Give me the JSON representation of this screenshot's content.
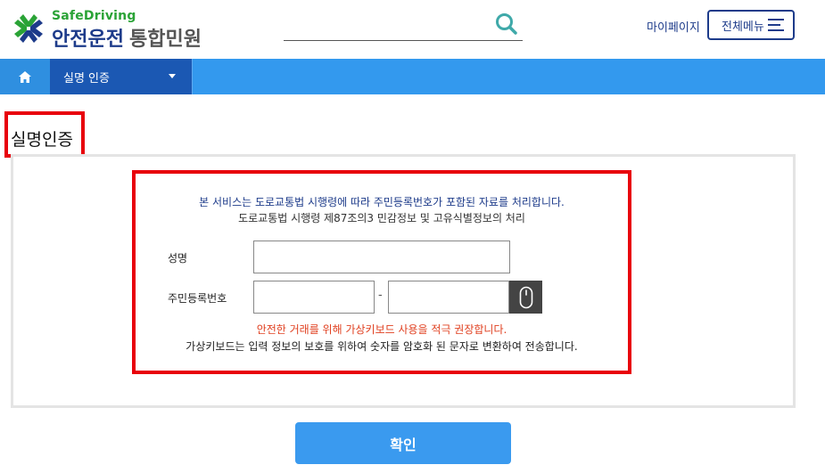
{
  "header": {
    "logo_sub": "SafeDriving",
    "logo_main": "안전운전",
    "logo_main_gray": "통합민원",
    "search_placeholder": "",
    "mypage_label": "마이페이지",
    "allmenu_label": "전체메뉴"
  },
  "nav": {
    "dropdown_label": "실명 인증"
  },
  "page": {
    "title": "실명인증"
  },
  "form": {
    "notice_line1": "본 서비스는 도로교통법 시행령에 따라 주민등록번호가 포함된 자료를 처리합니다.",
    "notice_line2": "도로교통법 시행령 제87조의3 민감정보 및 고유식별정보의 처리",
    "name_label": "성명",
    "rrn_label": "주민등록번호",
    "rrn_separator": "-",
    "name_value": "",
    "rrn_front_value": "",
    "rrn_back_value": "",
    "warning": "안전한 거래를 위해 가상키보드 사용을 적극 권장합니다.",
    "vkbd_note": "가상키보드는 입력 정보의 보호를 위하여 숫자를 암호화 된 문자로 변환하여 전송합니다.",
    "confirm_label": "확인"
  },
  "colors": {
    "brand_navy": "#1d3b8a",
    "brand_green": "#2aa336",
    "nav_blue": "#3399ee",
    "highlight_red": "#e8000b",
    "warning_red": "#e04020"
  },
  "icons": {
    "logo": "clover-logo-icon",
    "search": "search-icon",
    "home": "home-icon",
    "menu": "hamburger-icon",
    "caret": "caret-down-icon",
    "keyboard": "mouse-icon"
  }
}
